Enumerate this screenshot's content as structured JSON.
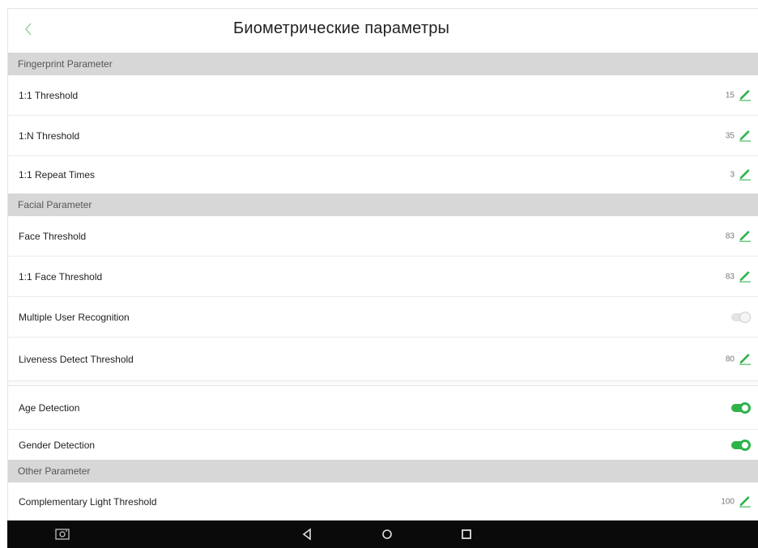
{
  "header": {
    "title": "Биометрические параметры",
    "back_icon": "chevron-left-icon"
  },
  "colors": {
    "accent": "#2db34a",
    "section_bg": "#d7d7d7",
    "navbar_bg": "#0a0a0a"
  },
  "sections": {
    "fingerprint": "Fingerprint Parameter",
    "facial": "Facial Parameter",
    "other": "Other Parameter"
  },
  "rows": {
    "t11": {
      "label": "1:1 Threshold",
      "value": "15"
    },
    "t1n": {
      "label": "1:N Threshold",
      "value": "35"
    },
    "repeat": {
      "label": "1:1 Repeat Times",
      "value": "3"
    },
    "face": {
      "label": "Face Threshold",
      "value": "83"
    },
    "face11": {
      "label": "1:1 Face Threshold",
      "value": "83"
    },
    "multi": {
      "label": "Multiple User Recognition",
      "enabled": false
    },
    "liveness": {
      "label": "Liveness Detect Threshold",
      "value": "80"
    },
    "age": {
      "label": "Age Detection",
      "enabled": true
    },
    "gender": {
      "label": "Gender Detection",
      "enabled": true
    },
    "light": {
      "label": "Complementary Light Threshold",
      "value": "100"
    }
  },
  "navbar": {
    "buttons": [
      "screenshot-icon",
      "back-triangle-icon",
      "home-circle-icon",
      "recents-square-icon"
    ]
  }
}
